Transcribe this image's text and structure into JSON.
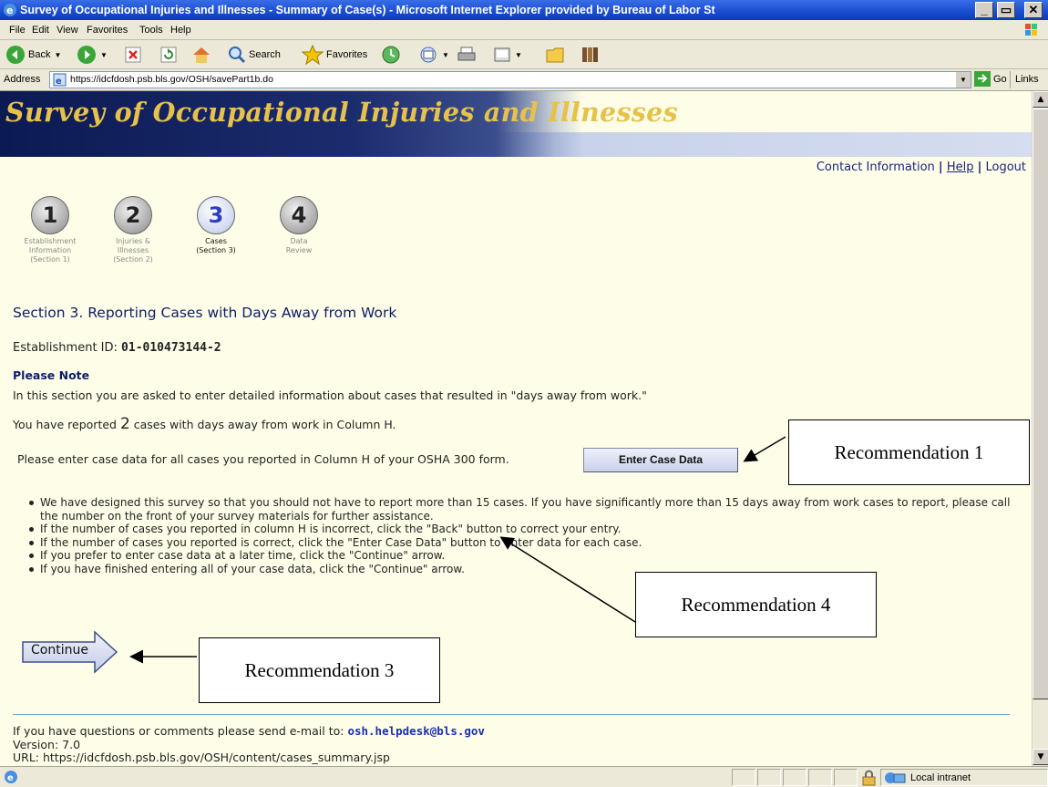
{
  "window": {
    "title": "Survey of Occupational Injuries and Illnesses - Summary of Case(s) - Microsoft Internet Explorer provided by Bureau of Labor St",
    "min_label": "_",
    "max_label": "ř",
    "close_label": "✕"
  },
  "menu": [
    "File",
    "Edit",
    "View",
    "Favorites",
    "Tools",
    "Help"
  ],
  "toolbar": {
    "back": "Back",
    "search": "Search",
    "favorites": "Favorites"
  },
  "address": {
    "label": "Address",
    "url": "https://idcfdosh.psb.bls.gov/OSH/savePart1b.do",
    "go": "Go",
    "links": "Links"
  },
  "banner": {
    "title": "Survey of Occupational Injuries and Illnesses"
  },
  "top_links": {
    "contact": "Contact Information",
    "sep": "|",
    "help": "Help",
    "logout": "Logout"
  },
  "steps": [
    {
      "num": "1",
      "label_lines": [
        "Establishment",
        "Information",
        "(Section 1)"
      ],
      "active": false
    },
    {
      "num": "2",
      "label_lines": [
        "Injuries &",
        "Illnesses",
        "(Section 2)"
      ],
      "active": false
    },
    {
      "num": "3",
      "label_lines": [
        "Cases",
        "(Section 3)"
      ],
      "active": true
    },
    {
      "num": "4",
      "label_lines": [
        "Data",
        "Review"
      ],
      "active": false
    }
  ],
  "section": {
    "heading": "Section 3. Reporting Cases with Days Away from Work",
    "estab_label": "Establishment ID:",
    "estab_id": "01-010473144-2",
    "note_heading": "Please Note",
    "note_text": "In this section you are asked to enter detailed information about cases that resulted in \"days away from work.\"",
    "reported_prefix": "You have reported",
    "reported_count": "2",
    "reported_suffix": "cases with days away from work in Column H.",
    "enter_prompt": "Please enter case data for all cases you reported in Column H of your OSHA 300 form.",
    "enter_button": "Enter Case Data",
    "bullets": [
      "We have designed this survey so that you should not have to report more than 15 cases. If you have significantly more than 15 days away from work cases to report, please call the number on the front of your survey materials for further assistance.",
      "If the number of cases you reported in column H is incorrect, click the \"Back\" button to correct your entry.",
      "If the number of cases you reported is correct, click the \"Enter Case Data\" button to enter data for each case.",
      "If you prefer to enter case data at a later time, click the \"Continue\" arrow.",
      "If you have finished entering all of your case data, click the \"Continue\" arrow."
    ],
    "continue": "Continue"
  },
  "footer": {
    "contact_text": "If you have questions or comments please send e-mail to:",
    "email": "osh.helpdesk@bls.gov",
    "version": "Version: 7.0",
    "url": "URL: https://idcfdosh.psb.bls.gov/OSH/content/cases_summary.jsp"
  },
  "callouts": {
    "rec1": "Recommendation 1",
    "rec3": "Recommendation 3",
    "rec4": "Recommendation 4"
  },
  "status": {
    "zone": "Local intranet"
  }
}
